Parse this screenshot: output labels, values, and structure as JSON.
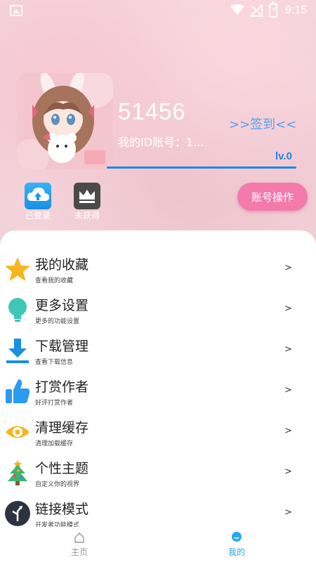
{
  "status_bar": {
    "time": "9:15"
  },
  "profile": {
    "username": "51456",
    "user_id": "我的ID账号：1...",
    "sign_in": ">>签到<<",
    "level": "lv.0"
  },
  "badges": [
    {
      "label": "已登录",
      "icon": "cloud-upload-icon"
    },
    {
      "label": "未获得",
      "icon": "crown-icon"
    }
  ],
  "account_button": "账号操作",
  "menu": [
    {
      "title": "我的收藏",
      "subtitle": "查看我的收藏",
      "icon": "star-icon",
      "arrow": ">"
    },
    {
      "title": "更多设置",
      "subtitle": "更多的功能设置",
      "icon": "lightbulb-icon",
      "arrow": ">"
    },
    {
      "title": "下载管理",
      "subtitle": "查看下载信息",
      "icon": "download-icon",
      "arrow": ">"
    },
    {
      "title": "打赏作者",
      "subtitle": "好评打赏作者",
      "icon": "thumbs-up-icon",
      "arrow": ">"
    },
    {
      "title": "清理缓存",
      "subtitle": "清理加载缓存",
      "icon": "eye-icon",
      "arrow": ">"
    },
    {
      "title": "个性主题",
      "subtitle": "自定义你的视界",
      "icon": "christmas-tree-icon",
      "arrow": ">"
    },
    {
      "title": "链接模式",
      "subtitle": "开发者功能模式",
      "icon": "route-sign-icon",
      "arrow": ">"
    }
  ],
  "bottom_nav": [
    {
      "label": "主页",
      "icon": "home-icon",
      "active": false
    },
    {
      "label": "我的",
      "icon": "profile-icon",
      "active": true
    }
  ],
  "colors": {
    "accent_blue": "#1e88e5",
    "pink_button": "#f57aac",
    "active_nav": "#29a8ec",
    "inactive_nav": "#999999"
  }
}
